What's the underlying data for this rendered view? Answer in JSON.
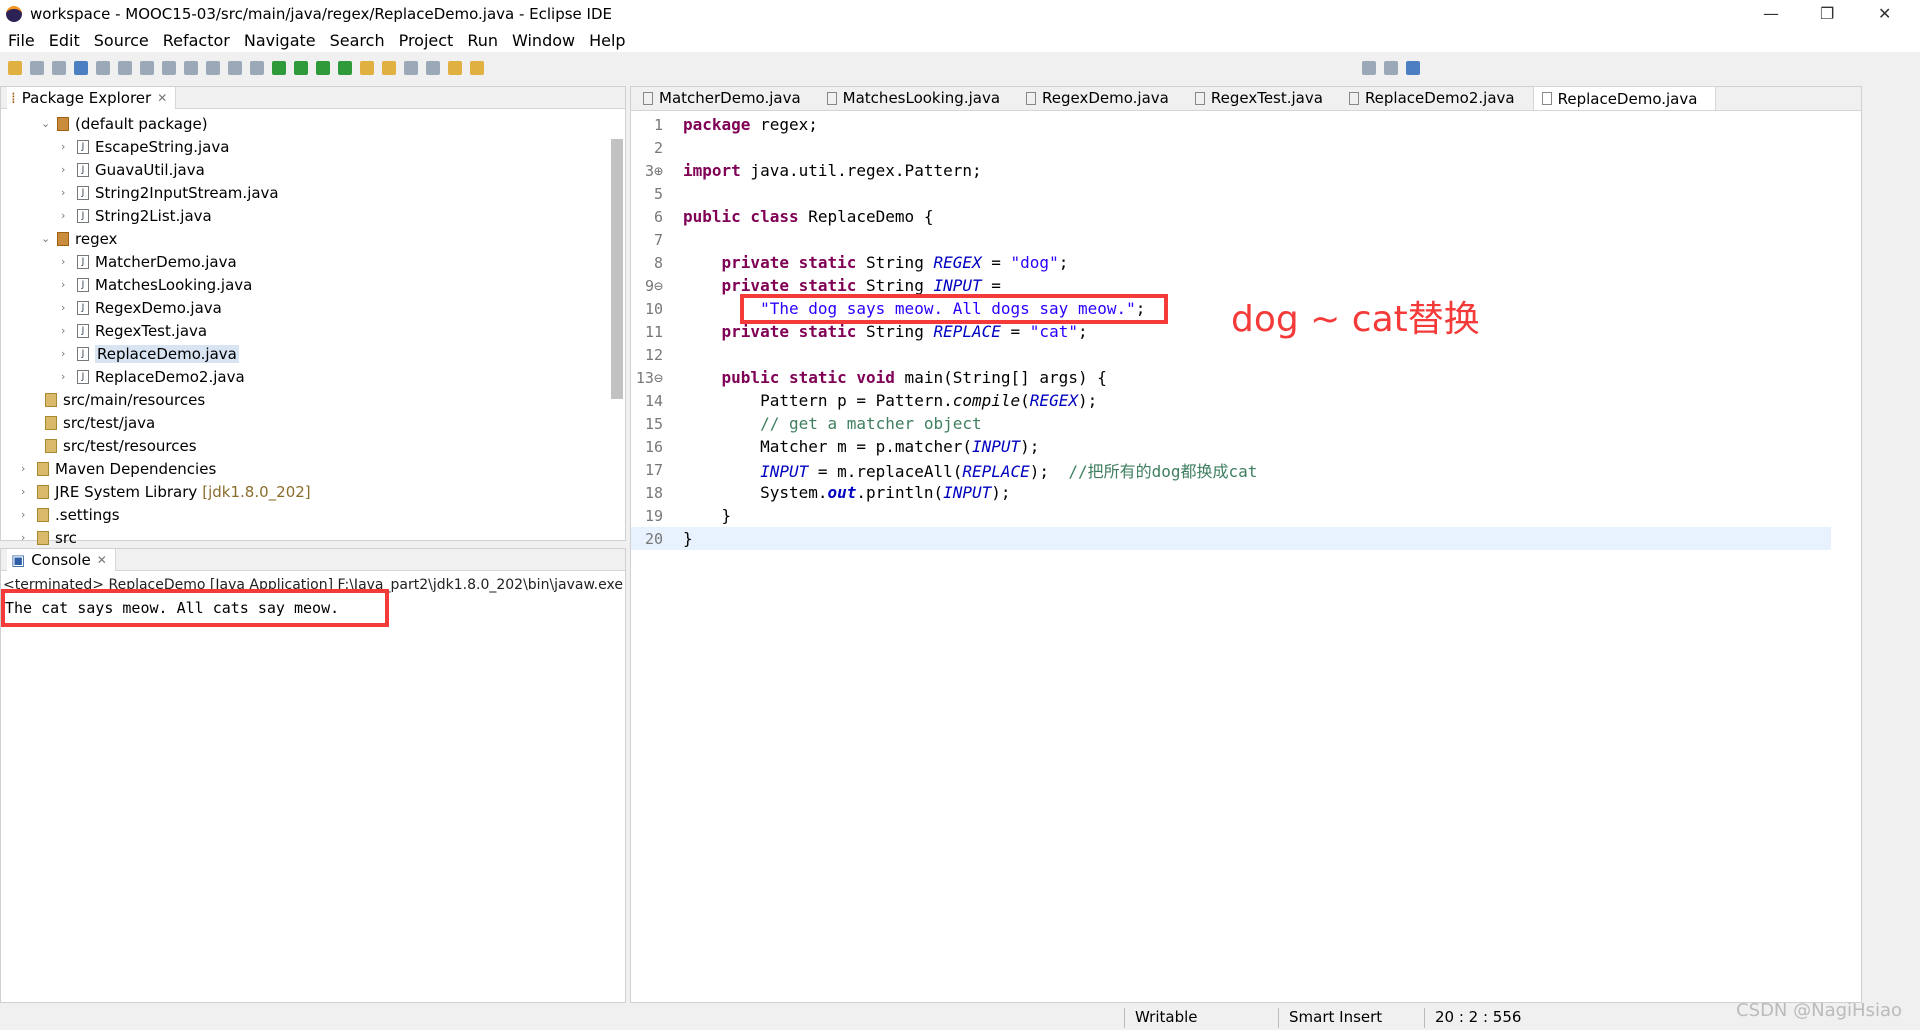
{
  "window": {
    "title": "workspace - MOOC15-03/src/main/java/regex/ReplaceDemo.java - Eclipse IDE",
    "minimize": "—",
    "restore": "❐",
    "close": "✕"
  },
  "menu": [
    "File",
    "Edit",
    "Source",
    "Refactor",
    "Navigate",
    "Search",
    "Project",
    "Run",
    "Window",
    "Help"
  ],
  "package_explorer": {
    "title": "Package Explorer",
    "items": [
      {
        "label": "(default package)",
        "type": "package",
        "expanded": true
      },
      {
        "label": "EscapeString.java",
        "type": "file"
      },
      {
        "label": "GuavaUtil.java",
        "type": "file"
      },
      {
        "label": "String2InputStream.java",
        "type": "file"
      },
      {
        "label": "String2List.java",
        "type": "file"
      },
      {
        "label": "regex",
        "type": "package",
        "expanded": true
      },
      {
        "label": "MatcherDemo.java",
        "type": "file"
      },
      {
        "label": "MatchesLooking.java",
        "type": "file"
      },
      {
        "label": "RegexDemo.java",
        "type": "file"
      },
      {
        "label": "RegexTest.java",
        "type": "file"
      },
      {
        "label": "ReplaceDemo.java",
        "type": "file",
        "selected": true
      },
      {
        "label": "ReplaceDemo2.java",
        "type": "file"
      },
      {
        "label": "src/main/resources",
        "type": "folder"
      },
      {
        "label": "src/test/java",
        "type": "folder"
      },
      {
        "label": "src/test/resources",
        "type": "folder"
      },
      {
        "label": "Maven Dependencies",
        "type": "library"
      },
      {
        "label": "JRE System Library",
        "suffix": "[jdk1.8.0_202]",
        "type": "library"
      },
      {
        "label": ".settings",
        "type": "folder"
      },
      {
        "label": "src",
        "type": "folder"
      }
    ]
  },
  "console": {
    "title": "Console",
    "terminated": "<terminated> ReplaceDemo [Java Application] F:\\Java_part2\\jdk1.8.0_202\\bin\\javaw.exe",
    "output": "The cat says meow. All cats say meow."
  },
  "editor": {
    "tabs": [
      "MatcherDemo.java",
      "MatchesLooking.java",
      "RegexDemo.java",
      "RegexTest.java",
      "ReplaceDemo2.java",
      "ReplaceDemo.java"
    ],
    "active_tab": "ReplaceDemo.java",
    "lines": [
      {
        "n": "1",
        "t": [
          [
            "kw",
            "package"
          ],
          [
            "tx",
            " regex;"
          ]
        ]
      },
      {
        "n": "2",
        "t": []
      },
      {
        "n": "3⊕",
        "t": [
          [
            "kw",
            "import"
          ],
          [
            "tx",
            " java.util.regex.Pattern;"
          ]
        ]
      },
      {
        "n": "5",
        "t": []
      },
      {
        "n": "6",
        "t": [
          [
            "kw",
            "public class"
          ],
          [
            "tx",
            " ReplaceDemo "
          ],
          [
            "tx",
            "{"
          ]
        ]
      },
      {
        "n": "7",
        "t": []
      },
      {
        "n": "8",
        "t": [
          [
            "tx",
            "    "
          ],
          [
            "kw",
            "private static"
          ],
          [
            "tx",
            " String "
          ],
          [
            "fi",
            "REGEX"
          ],
          [
            "tx",
            " = "
          ],
          [
            "st",
            "\"dog\""
          ],
          [
            "tx",
            ";"
          ]
        ]
      },
      {
        "n": "9⊖",
        "t": [
          [
            "tx",
            "    "
          ],
          [
            "kw",
            "private static"
          ],
          [
            "tx",
            " String "
          ],
          [
            "fi",
            "INPUT"
          ],
          [
            "tx",
            " ="
          ]
        ]
      },
      {
        "n": "10",
        "t": [
          [
            "tx",
            "        "
          ],
          [
            "st",
            "\"The dog says meow. All dogs say meow.\""
          ],
          [
            "tx",
            ";"
          ]
        ]
      },
      {
        "n": "11",
        "t": [
          [
            "tx",
            "    "
          ],
          [
            "kw",
            "private static"
          ],
          [
            "tx",
            " String "
          ],
          [
            "fi",
            "REPLACE"
          ],
          [
            "tx",
            " = "
          ],
          [
            "st",
            "\"cat\""
          ],
          [
            "tx",
            ";"
          ]
        ]
      },
      {
        "n": "12",
        "t": []
      },
      {
        "n": "13⊖",
        "t": [
          [
            "tx",
            "    "
          ],
          [
            "kw",
            "public static void"
          ],
          [
            "tx",
            " main(String[] args) {"
          ]
        ]
      },
      {
        "n": "14",
        "t": [
          [
            "tx",
            "        Pattern p = Pattern."
          ],
          [
            "it",
            "compile"
          ],
          [
            "tx",
            "("
          ],
          [
            "fi",
            "REGEX"
          ],
          [
            "tx",
            ");"
          ]
        ]
      },
      {
        "n": "15",
        "t": [
          [
            "tx",
            "        "
          ],
          [
            "cm",
            "// get a matcher object"
          ]
        ]
      },
      {
        "n": "16",
        "t": [
          [
            "tx",
            "        Matcher m = p.matcher("
          ],
          [
            "fi",
            "INPUT"
          ],
          [
            "tx",
            ");"
          ]
        ]
      },
      {
        "n": "17",
        "t": [
          [
            "tx",
            "        "
          ],
          [
            "fi",
            "INPUT"
          ],
          [
            "tx",
            " = m.replaceAll("
          ],
          [
            "fi",
            "REPLACE"
          ],
          [
            "tx",
            ");  "
          ],
          [
            "cm",
            "//把所有的dog都换成cat"
          ]
        ]
      },
      {
        "n": "18",
        "t": [
          [
            "tx",
            "        System."
          ],
          [
            "fb",
            "out"
          ],
          [
            "tx",
            ".println("
          ],
          [
            "fi",
            "INPUT"
          ],
          [
            "tx",
            ");"
          ]
        ]
      },
      {
        "n": "19",
        "t": [
          [
            "tx",
            "    }"
          ]
        ]
      },
      {
        "n": "20",
        "t": [
          [
            "tx",
            "}"
          ]
        ]
      }
    ]
  },
  "annotation": "dog ~ cat替换",
  "status": {
    "writable": "Writable",
    "insert_mode": "Smart Insert",
    "position": "20 : 2 : 556"
  },
  "watermark": "CSDN @NagiHsiao",
  "colors": {
    "annotation": "#f53a3a",
    "keyword": "#7f0055",
    "string": "#2a00ff",
    "comment": "#3f7f5f",
    "field": "#0000c0"
  }
}
